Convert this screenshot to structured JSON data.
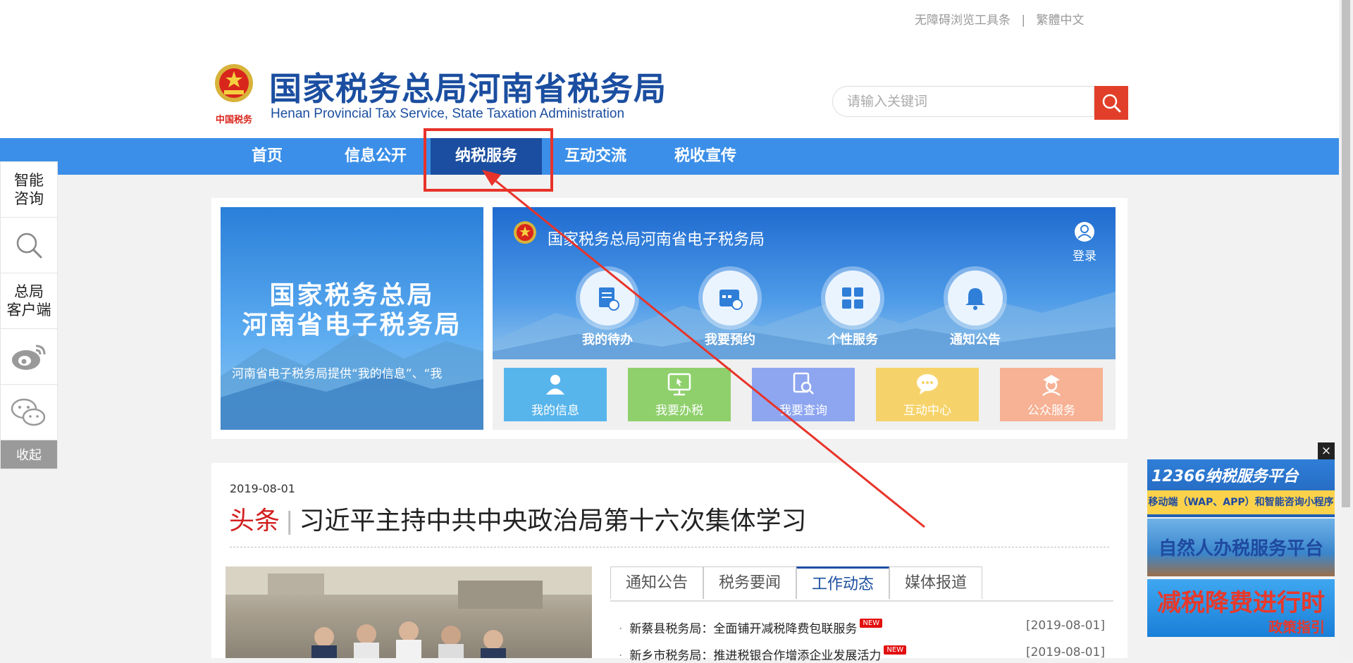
{
  "top_links": {
    "accessibility": "无障碍浏览工具条",
    "separator": "|",
    "traditional": "繁體中文"
  },
  "site": {
    "title": "国家税务总局河南省税务局",
    "subtitle": "Henan Provincial Tax Service, State Taxation Administration",
    "emblem_text": "中国税务"
  },
  "search": {
    "placeholder": "请输入关键词"
  },
  "nav": {
    "items": [
      {
        "label": "首页"
      },
      {
        "label": "信息公开"
      },
      {
        "label": "纳税服务"
      },
      {
        "label": "互动交流"
      },
      {
        "label": "税收宣传"
      }
    ],
    "active": "纳税服务"
  },
  "left_sidebar": {
    "smart": "智能咨询",
    "smart_l1": "智能",
    "smart_l2": "咨询",
    "client_l1": "总局",
    "client_l2": "客户端",
    "collapse": "收起"
  },
  "banner": {
    "title_l1": "国家税务总局",
    "title_l2": "河南省电子税务局",
    "scroll_text": "河南省电子税务局提供“我的信息”、“我"
  },
  "etax": {
    "title": "国家税务总局河南省电子税务局",
    "login": "登录",
    "icons": [
      {
        "label": "我的待办"
      },
      {
        "label": "我要预约"
      },
      {
        "label": "个性服务"
      },
      {
        "label": "通知公告"
      }
    ],
    "tiles": [
      {
        "label": "我的信息",
        "color": "#58b5ec"
      },
      {
        "label": "我要办税",
        "color": "#8fd06c"
      },
      {
        "label": "我要查询",
        "color": "#8ea6f0"
      },
      {
        "label": "互动中心",
        "color": "#f6d36a"
      },
      {
        "label": "公众服务",
        "color": "#f7b194"
      }
    ]
  },
  "news": {
    "date": "2019-08-01",
    "tag": "头条",
    "bar": "|",
    "headline": "习近平主持中共中央政治局第十六次集体学习",
    "tabs": [
      {
        "label": "通知公告"
      },
      {
        "label": "税务要闻"
      },
      {
        "label": "工作动态"
      },
      {
        "label": "媒体报道"
      }
    ],
    "active_tab": "工作动态",
    "items": [
      {
        "title": "新蔡县税务局：全面铺开减税降费包联服务",
        "badge": "NEW",
        "date": "[2019-08-01]"
      },
      {
        "title": "新乡市税务局：推进税银合作增添企业发展活力",
        "badge": "NEW",
        "date": "[2019-08-01]"
      }
    ]
  },
  "ads": {
    "close": "×",
    "ad1_l1": "12366纳税服务平台",
    "ad1_l2": "移动端（WAP、APP）和智能咨询小程序",
    "ad2": "自然人办税服务平台",
    "ad3_l1": "减税降费进行时",
    "ad3_l2": "政策指引"
  },
  "colors": {
    "brand": "#1b4ea0",
    "nav": "#3b8fe8",
    "accent_red": "#e23f2a",
    "highlight": "#e8332a"
  }
}
